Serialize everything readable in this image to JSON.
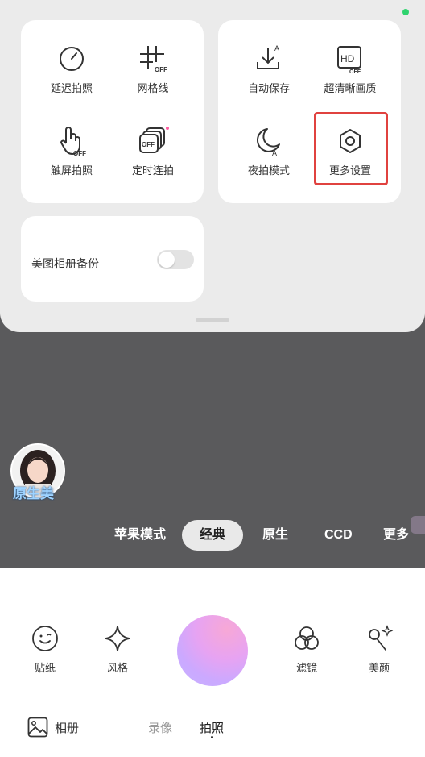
{
  "panel": {
    "tiles_left": [
      {
        "label": "延迟拍照",
        "icon": "timer-icon"
      },
      {
        "label": "网格线",
        "icon": "grid-off-icon"
      },
      {
        "label": "触屏拍照",
        "icon": "touch-off-icon"
      },
      {
        "label": "定时连拍",
        "icon": "burst-off-icon"
      }
    ],
    "tiles_right": [
      {
        "label": "自动保存",
        "icon": "auto-save-icon"
      },
      {
        "label": "超清晰画质",
        "icon": "hd-off-icon"
      },
      {
        "label": "夜拍模式",
        "icon": "night-mode-icon"
      },
      {
        "label": "更多设置",
        "icon": "hexagon-settings-icon"
      }
    ],
    "backup": {
      "label": "美图相册备份",
      "enabled": false
    },
    "icon_text": {
      "off": "OFF",
      "a": "A",
      "hd": "HD"
    }
  },
  "avatar_caption": "原生美",
  "modes": [
    "苹果模式",
    "经典",
    "原生",
    "CCD",
    "更多"
  ],
  "active_mode": "经典",
  "tools": {
    "stickers": "贴纸",
    "style": "风格",
    "filters": "滤镜",
    "beauty": "美颜"
  },
  "bottom": {
    "album": "相册",
    "video": "录像",
    "photo": "拍照"
  },
  "colors": {
    "highlight": "#e0423f",
    "shutter_top": "#f7a8d6",
    "shutter_bottom": "#c6b3ff",
    "status": "#2fd36e"
  }
}
